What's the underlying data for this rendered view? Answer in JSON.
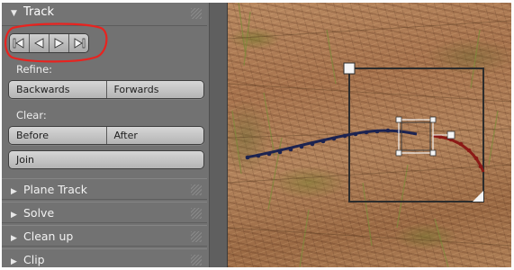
{
  "panel": {
    "track": {
      "title": "Track"
    },
    "refine": {
      "label": "Refine:",
      "backwards_label": "Backwards",
      "forwards_label": "Forwards"
    },
    "clear": {
      "label": "Clear:",
      "before_label": "Before",
      "after_label": "After"
    },
    "join_label": "Join",
    "sections": [
      {
        "title": "Plane Track"
      },
      {
        "title": "Solve"
      },
      {
        "title": "Clean up"
      },
      {
        "title": "Clip"
      }
    ]
  },
  "icons": {
    "track_buttons": [
      "track-backwards-sequence-icon",
      "track-backwards-frame-icon",
      "track-forwards-frame-icon",
      "track-forwards-sequence-icon"
    ],
    "expanded": "triangle-down-icon",
    "collapsed": "triangle-right-icon"
  },
  "colors": {
    "annotation_circle": "#e8231f",
    "track_path_past": "#1c2350",
    "track_path_future": "#8b1a16",
    "marker_frame": "#2c2c2c",
    "pattern_frame": "#f2f2f2"
  }
}
